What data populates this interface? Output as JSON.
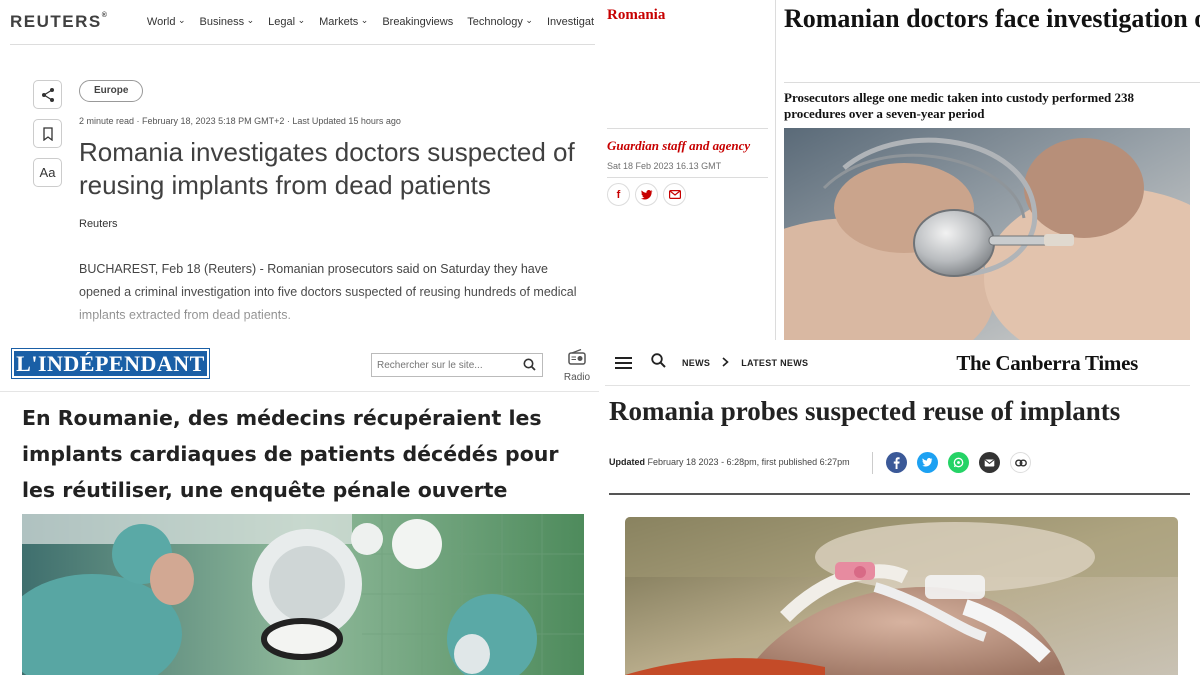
{
  "reuters": {
    "logo": "REUTERS",
    "logo_mark": "®",
    "nav": [
      "World",
      "Business",
      "Legal",
      "Markets",
      "Breakingviews",
      "Technology",
      "Investigat"
    ],
    "share_icon": "share-icon",
    "bookmark_icon": "bookmark-icon",
    "text_size_label": "Aa",
    "section_pill": "Europe",
    "meta": "2 minute read · February 18, 2023 5:18 PM GMT+2 · Last Updated 15 hours ago",
    "headline": "Romania investigates doctors suspected of reusing implants from dead patients",
    "byline": "Reuters",
    "body": "BUCHAREST, Feb 18 (Reuters) - Romanian prosecutors said on Saturday they have opened a criminal investigation into five doctors suspected of reusing hundreds of medical implants extracted from dead patients."
  },
  "guardian": {
    "kicker": "Romania",
    "headline": "Romanian doctors face investigation over reuse of implants from corpses",
    "standfirst": "Prosecutors allege one medic taken into custody performed 238 procedures over a seven-year period",
    "byline": "Guardian staff and agency",
    "date": "Sat 18 Feb 2023 16.13 GMT",
    "share_labels": [
      "f",
      "t",
      "email"
    ],
    "accent": "#c70000"
  },
  "independant": {
    "logo": "L'INDÉPENDANT",
    "search_placeholder": "Rechercher sur le site...",
    "radio_label": "Radio",
    "headline": "En Roumanie, des médecins récupéraient les implants cardiaques de patients décédés pour les réutiliser, une enquête pénale ouverte",
    "brand_color": "#1a5fa6"
  },
  "canberra": {
    "crumb_news": "NEWS",
    "crumb_latest": "LATEST NEWS",
    "logo": "The Canberra Times",
    "headline": "Romania probes suspected reuse of implants",
    "updated_label": "Updated",
    "updated_text": "February 18 2023 - 6:28pm, first published 6:27pm",
    "share_colors": [
      "#3b5998",
      "#1da1f2",
      "#25d366",
      "#333333"
    ]
  }
}
